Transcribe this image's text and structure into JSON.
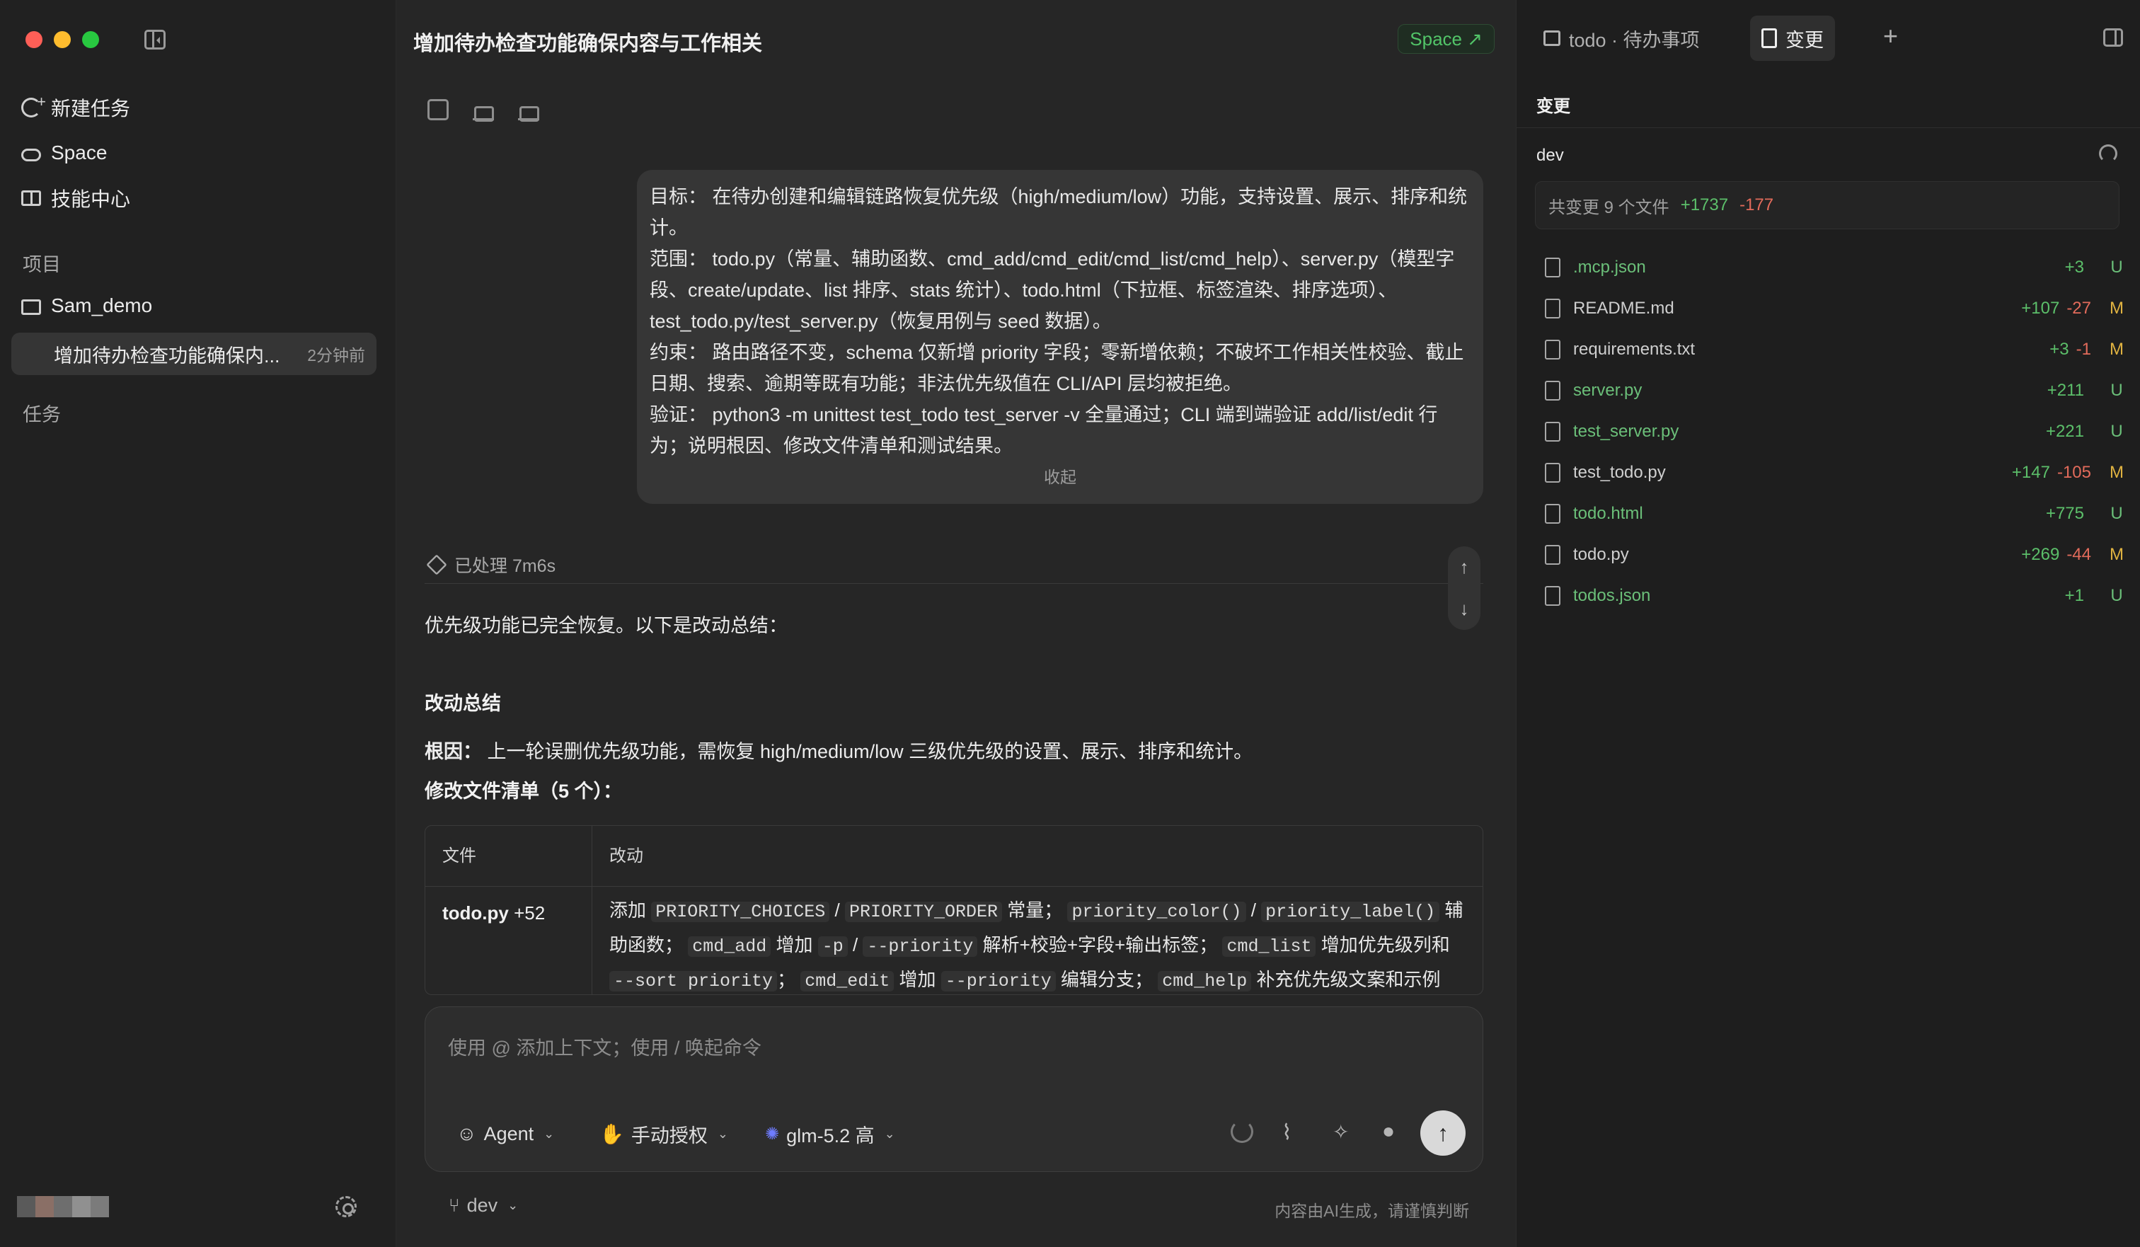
{
  "sidebar": {
    "nav": [
      {
        "label": "新建任务",
        "icon": "new-task-icon"
      },
      {
        "label": "Space",
        "icon": "cloud-icon"
      },
      {
        "label": "技能中心",
        "icon": "book-icon"
      }
    ],
    "projects_label": "项目",
    "project_name": "Sam_demo",
    "task_title": "增加待办检查功能确保内...",
    "task_time": "2分钟前",
    "tasks_label": "任务"
  },
  "main": {
    "title": "增加待办检查功能确保内容与工作相关",
    "space_badge": "Space ↗",
    "user_message": [
      "目标： 在待办创建和编辑链路恢复优先级（high/medium/low）功能，支持设置、展示、排序和统计。",
      "范围： todo.py（常量、辅助函数、cmd_add/cmd_edit/cmd_list/cmd_help）、server.py（模型字段、create/update、list 排序、stats 统计）、todo.html（下拉框、标签渲染、排序选项）、test_todo.py/test_server.py（恢复用例与 seed 数据）。",
      "约束： 路由路径不变，schema 仅新增 priority 字段；零新增依赖；不破坏工作相关性校验、截止日期、搜索、逾期等既有功能；非法优先级值在 CLI/API 层均被拒绝。",
      "验证： python3 -m unittest test_todo test_server -v 全量通过；CLI 端到端验证 add/list/edit 行为；说明根因、修改文件清单和测试结果。"
    ],
    "collapse_label": "收起",
    "processed_label": "已处理 7m6s",
    "answer_intro": "优先级功能已完全恢复。以下是改动总结：",
    "summary_heading": "改动总结",
    "root_cause_label": "根因：",
    "root_cause_text": "上一轮误删优先级功能，需恢复 high/medium/low 三级优先级的设置、展示、排序和统计。",
    "files_heading": "修改文件清单（5 个）：",
    "table": {
      "col_file": "文件",
      "col_change": "改动",
      "row_file": "todo.py",
      "row_delta": "+52",
      "row_change_parts": [
        "添加 ",
        "PRIORITY_CHOICES",
        " / ",
        "PRIORITY_ORDER",
        " 常量； ",
        "priority_color()",
        " / ",
        "priority_label()",
        " 辅助函数； ",
        "cmd_add",
        " 增加 ",
        "-p",
        " / ",
        "--priority",
        " 解析+校验+字段+输出标签； ",
        "cmd_list",
        " 增加优先级列和 ",
        "--sort priority",
        "； ",
        "cmd_edit",
        " 增加 ",
        "--priority",
        " 编辑分支； ",
        "cmd_help",
        " 补充优先级文案和示例"
      ]
    },
    "composer": {
      "placeholder": "使用 @ 添加上下文；使用 / 唤起命令",
      "agent_label": "Agent",
      "auth_label": "手动授权",
      "model_label": "glm-5.2 高"
    },
    "footer_branch": "dev",
    "footer_note": "内容由AI生成，请谨慎判断"
  },
  "right_panel": {
    "tab_todo": "todo · 待办事项",
    "tab_changes": "变更",
    "heading": "变更",
    "branch": "dev",
    "summary_label": "共变更 9 个文件",
    "summary_add": "+1737",
    "summary_del": "-177",
    "files": [
      {
        "name": ".mcp.json",
        "add": "+3",
        "del": "",
        "status": "U"
      },
      {
        "name": "README.md",
        "add": "+107",
        "del": "-27",
        "status": "M"
      },
      {
        "name": "requirements.txt",
        "add": "+3",
        "del": "-1",
        "status": "M"
      },
      {
        "name": "server.py",
        "add": "+211",
        "del": "",
        "status": "U"
      },
      {
        "name": "test_server.py",
        "add": "+221",
        "del": "",
        "status": "U"
      },
      {
        "name": "test_todo.py",
        "add": "+147",
        "del": "-105",
        "status": "M"
      },
      {
        "name": "todo.html",
        "add": "+775",
        "del": "",
        "status": "U"
      },
      {
        "name": "todo.py",
        "add": "+269",
        "del": "-44",
        "status": "M"
      },
      {
        "name": "todos.json",
        "add": "+1",
        "del": "",
        "status": "U"
      }
    ]
  },
  "colors": {
    "added": "#5cbf6a",
    "deleted": "#e26b5b",
    "untracked": "#6bbf79",
    "modified": "#e0b341",
    "accent": "#52c468"
  }
}
